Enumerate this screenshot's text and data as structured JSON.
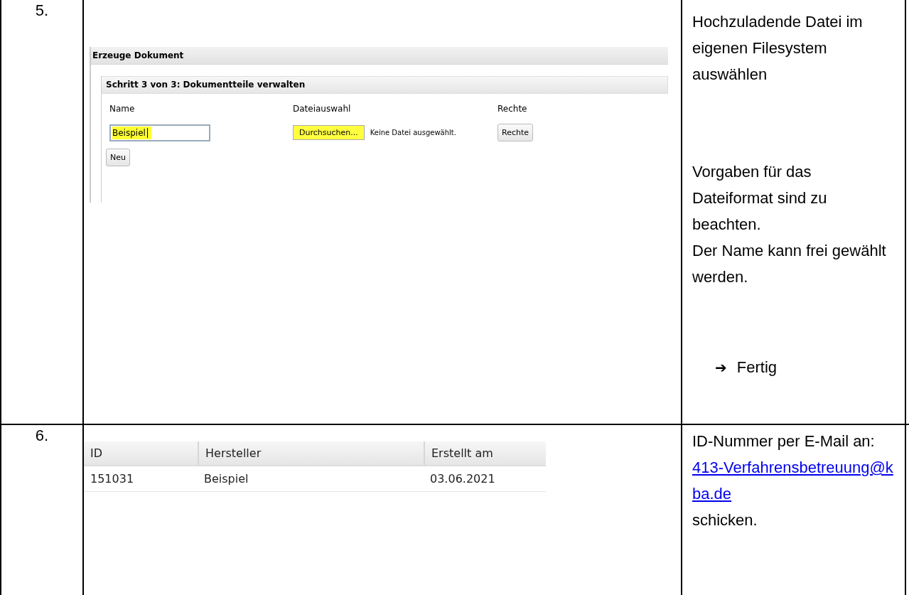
{
  "rows": [
    {
      "number": "5.",
      "kind": "upload",
      "screenshot": {
        "dialog_title": "Erzeuge Dokument",
        "step_title": "Schritt 3 von 3: Dokumentteile verwalten",
        "columns": [
          "Name",
          "Dateiauswahl",
          "Rechte"
        ],
        "name_value": "Beispiel",
        "browse_button": "Durchsuchen...",
        "file_status": "Keine Datei ausgewählt.",
        "rights_button": "Rechte",
        "new_button": "Neu"
      },
      "notes": [
        {
          "kind": "text",
          "text": "Hochzuladende Datei im eigenen Filesystem auswählen"
        },
        {
          "kind": "text",
          "text": "Vorgaben für das Dateiformat sind zu beachten."
        },
        {
          "kind": "text",
          "text": "Der Name kann frei gewählt werden."
        },
        {
          "kind": "step",
          "arrow": "➔",
          "text": "Fertig"
        }
      ]
    },
    {
      "number": "6.",
      "kind": "table",
      "screenshot": {
        "columns": [
          "ID",
          "Hersteller",
          "Erstellt am"
        ],
        "rows": [
          [
            "151031",
            "Beispiel",
            "03.06.2021"
          ]
        ]
      },
      "notes": [
        {
          "kind": "mail",
          "before": "ID-Nummer per E-Mail an: ",
          "link": "413-Verfahrensbetreuung@kba.de",
          "after": "schicken."
        }
      ]
    }
  ]
}
